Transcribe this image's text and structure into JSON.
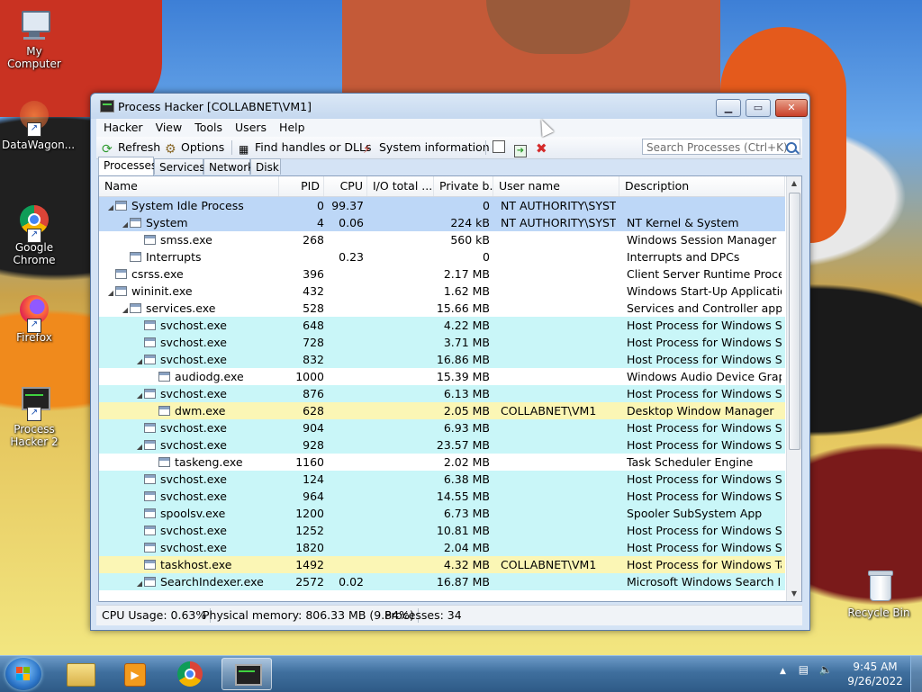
{
  "desktop": {
    "icons": [
      {
        "label": "My Computer"
      },
      {
        "label": "DataWagon..."
      },
      {
        "label": "Google Chrome"
      },
      {
        "label": "Firefox"
      },
      {
        "label": "Process Hacker 2"
      },
      {
        "label": "Recycle Bin"
      }
    ]
  },
  "window": {
    "title": "Process Hacker [COLLABNET\\VM1]",
    "menu": [
      "Hacker",
      "View",
      "Tools",
      "Users",
      "Help"
    ],
    "toolbar": {
      "refresh": "Refresh",
      "options": "Options",
      "find_handles": "Find handles or DLLs",
      "system_info": "System information",
      "search_placeholder": "Search Processes (Ctrl+K)"
    },
    "tabs": [
      "Processes",
      "Services",
      "Network",
      "Disk"
    ],
    "active_tab": "Processes",
    "columns": [
      "Name",
      "PID",
      "CPU",
      "I/O total ...",
      "Private b...",
      "User name",
      "Description"
    ],
    "processes": [
      {
        "name": "System Idle Process",
        "depth": 0,
        "expanded": true,
        "pid": "0",
        "cpu": "99.37",
        "io": "",
        "private": "0",
        "user": "NT AUTHORITY\\SYSTEM",
        "desc": "",
        "kind": "sys"
      },
      {
        "name": "System",
        "depth": 1,
        "expanded": true,
        "pid": "4",
        "cpu": "0.06",
        "io": "",
        "private": "224 kB",
        "user": "NT AUTHORITY\\SYSTEM",
        "desc": "NT Kernel & System",
        "kind": "sys"
      },
      {
        "name": "smss.exe",
        "depth": 2,
        "expanded": null,
        "pid": "268",
        "cpu": "",
        "io": "",
        "private": "560 kB",
        "user": "",
        "desc": "Windows Session Manager",
        "kind": "none"
      },
      {
        "name": "Interrupts",
        "depth": 1,
        "expanded": null,
        "pid": "",
        "cpu": "0.23",
        "io": "",
        "private": "0",
        "user": "",
        "desc": "Interrupts and DPCs",
        "kind": "none"
      },
      {
        "name": "csrss.exe",
        "depth": 0,
        "expanded": null,
        "pid": "396",
        "cpu": "",
        "io": "",
        "private": "2.17 MB",
        "user": "",
        "desc": "Client Server Runtime Process",
        "kind": "none"
      },
      {
        "name": "wininit.exe",
        "depth": 0,
        "expanded": true,
        "pid": "432",
        "cpu": "",
        "io": "",
        "private": "1.62 MB",
        "user": "",
        "desc": "Windows Start-Up Application",
        "kind": "none"
      },
      {
        "name": "services.exe",
        "depth": 1,
        "expanded": true,
        "pid": "528",
        "cpu": "",
        "io": "",
        "private": "15.66 MB",
        "user": "",
        "desc": "Services and Controller app",
        "kind": "none"
      },
      {
        "name": "svchost.exe",
        "depth": 2,
        "expanded": null,
        "pid": "648",
        "cpu": "",
        "io": "",
        "private": "4.22 MB",
        "user": "",
        "desc": "Host Process for Windows Ser...",
        "kind": "svc"
      },
      {
        "name": "svchost.exe",
        "depth": 2,
        "expanded": null,
        "pid": "728",
        "cpu": "",
        "io": "",
        "private": "3.71 MB",
        "user": "",
        "desc": "Host Process for Windows Ser...",
        "kind": "svc"
      },
      {
        "name": "svchost.exe",
        "depth": 2,
        "expanded": true,
        "pid": "832",
        "cpu": "",
        "io": "",
        "private": "16.86 MB",
        "user": "",
        "desc": "Host Process for Windows Ser...",
        "kind": "svc"
      },
      {
        "name": "audiodg.exe",
        "depth": 3,
        "expanded": null,
        "pid": "1000",
        "cpu": "",
        "io": "",
        "private": "15.39 MB",
        "user": "",
        "desc": "Windows Audio Device Graph...",
        "kind": "none"
      },
      {
        "name": "svchost.exe",
        "depth": 2,
        "expanded": true,
        "pid": "876",
        "cpu": "",
        "io": "",
        "private": "6.13 MB",
        "user": "",
        "desc": "Host Process for Windows Ser...",
        "kind": "svc"
      },
      {
        "name": "dwm.exe",
        "depth": 3,
        "expanded": null,
        "pid": "628",
        "cpu": "",
        "io": "",
        "private": "2.05 MB",
        "user": "COLLABNET\\VM1",
        "desc": "Desktop Window Manager",
        "kind": "user"
      },
      {
        "name": "svchost.exe",
        "depth": 2,
        "expanded": null,
        "pid": "904",
        "cpu": "",
        "io": "",
        "private": "6.93 MB",
        "user": "",
        "desc": "Host Process for Windows Ser...",
        "kind": "svc"
      },
      {
        "name": "svchost.exe",
        "depth": 2,
        "expanded": true,
        "pid": "928",
        "cpu": "",
        "io": "",
        "private": "23.57 MB",
        "user": "",
        "desc": "Host Process for Windows Ser...",
        "kind": "svc"
      },
      {
        "name": "taskeng.exe",
        "depth": 3,
        "expanded": null,
        "pid": "1160",
        "cpu": "",
        "io": "",
        "private": "2.02 MB",
        "user": "",
        "desc": "Task Scheduler Engine",
        "kind": "none"
      },
      {
        "name": "svchost.exe",
        "depth": 2,
        "expanded": null,
        "pid": "124",
        "cpu": "",
        "io": "",
        "private": "6.38 MB",
        "user": "",
        "desc": "Host Process for Windows Ser...",
        "kind": "svc"
      },
      {
        "name": "svchost.exe",
        "depth": 2,
        "expanded": null,
        "pid": "964",
        "cpu": "",
        "io": "",
        "private": "14.55 MB",
        "user": "",
        "desc": "Host Process for Windows Ser...",
        "kind": "svc"
      },
      {
        "name": "spoolsv.exe",
        "depth": 2,
        "expanded": null,
        "pid": "1200",
        "cpu": "",
        "io": "",
        "private": "6.73 MB",
        "user": "",
        "desc": "Spooler SubSystem App",
        "kind": "svc"
      },
      {
        "name": "svchost.exe",
        "depth": 2,
        "expanded": null,
        "pid": "1252",
        "cpu": "",
        "io": "",
        "private": "10.81 MB",
        "user": "",
        "desc": "Host Process for Windows Ser...",
        "kind": "svc"
      },
      {
        "name": "svchost.exe",
        "depth": 2,
        "expanded": null,
        "pid": "1820",
        "cpu": "",
        "io": "",
        "private": "2.04 MB",
        "user": "",
        "desc": "Host Process for Windows Ser...",
        "kind": "svc"
      },
      {
        "name": "taskhost.exe",
        "depth": 2,
        "expanded": null,
        "pid": "1492",
        "cpu": "",
        "io": "",
        "private": "4.32 MB",
        "user": "COLLABNET\\VM1",
        "desc": "Host Process for Windows Tas...",
        "kind": "user"
      },
      {
        "name": "SearchIndexer.exe",
        "depth": 2,
        "expanded": true,
        "pid": "2572",
        "cpu": "0.02",
        "io": "",
        "private": "16.87 MB",
        "user": "",
        "desc": "Microsoft Windows Search In...",
        "kind": "svc"
      }
    ],
    "status": {
      "cpu": "CPU Usage: 0.63%",
      "memory": "Physical memory: 806.33 MB (9.84%)",
      "processes": "Processes: 34"
    }
  },
  "taskbar": {
    "time": "9:45 AM",
    "date": "9/26/2022"
  },
  "colors": {
    "system_row": "#bdd7f7",
    "service_row": "#c9f6f8",
    "user_row": "#fbf6b5"
  }
}
